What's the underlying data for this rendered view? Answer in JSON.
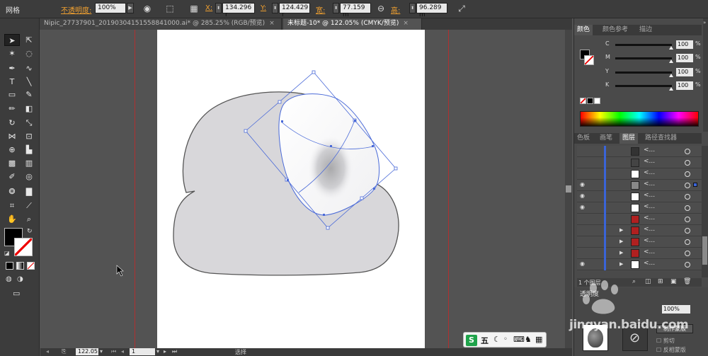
{
  "control_bar": {
    "mode_label": "网格",
    "opacity_label": "不透明度:",
    "opacity_value": "100%",
    "x_label": "X:",
    "x_value": "134.296 r",
    "y_label": "Y:",
    "y_value": "124.429 r",
    "w_label": "宽:",
    "w_value": "77.159 m",
    "h_label": "高:",
    "h_value": "96.289 m"
  },
  "tabs": [
    {
      "label": "Nipic_27737901_20190304151558841000.ai* @ 285.25% (RGB/预览)",
      "active": false
    },
    {
      "label": "未标题-10* @ 122.05% (CMYK/预览)",
      "active": true
    }
  ],
  "color_panel": {
    "tabs": [
      "颜色",
      "颜色参考",
      "描边"
    ],
    "channels": [
      {
        "name": "C",
        "value": "100"
      },
      {
        "name": "M",
        "value": "100"
      },
      {
        "name": "Y",
        "value": "100"
      },
      {
        "name": "K",
        "value": "100"
      }
    ],
    "percent": "%"
  },
  "layers_panel": {
    "tabs": [
      "色板",
      "画笔",
      "图层",
      "路径查找器"
    ],
    "rows": [
      {
        "visible": false,
        "expand": false,
        "name": "<...",
        "thumb_color": "#333333",
        "selected": false
      },
      {
        "visible": false,
        "expand": false,
        "name": "<...",
        "thumb_color": "#444444",
        "selected": false
      },
      {
        "visible": false,
        "expand": false,
        "name": "<...",
        "thumb_color": "#ffffff",
        "selected": false
      },
      {
        "visible": true,
        "expand": false,
        "name": "<...",
        "thumb_color": "#888888",
        "selected": true
      },
      {
        "visible": true,
        "expand": false,
        "name": "<...",
        "thumb_color": "#ffffff",
        "selected": false
      },
      {
        "visible": true,
        "expand": false,
        "name": "<...",
        "thumb_color": "#ffffff",
        "selected": false
      },
      {
        "visible": false,
        "expand": false,
        "name": "<...",
        "thumb_color": "#b02020",
        "selected": false
      },
      {
        "visible": false,
        "expand": true,
        "name": "<...",
        "thumb_color": "#b02020",
        "selected": false
      },
      {
        "visible": false,
        "expand": true,
        "name": "<...",
        "thumb_color": "#b02020",
        "selected": false
      },
      {
        "visible": false,
        "expand": true,
        "name": "<...",
        "thumb_color": "#b02020",
        "selected": false
      },
      {
        "visible": true,
        "expand": true,
        "name": "<...",
        "thumb_color": "#ffffff",
        "selected": false
      }
    ],
    "footer": "1 个图层"
  },
  "status": {
    "zoom": "122.05",
    "page": "1",
    "mode": "选择"
  },
  "bottom_panel": {
    "tab": "透明度",
    "opacity": "100%",
    "make_mask": "制作蒙版",
    "clip": "剪切",
    "invert": "反相蒙版"
  },
  "watermark": {
    "text": "jingyan.baidu.com"
  },
  "ime": {
    "label": "五"
  },
  "colors": {
    "accent": "#3a64d8",
    "guide": "#b03030",
    "selection": "#4a6ad8"
  }
}
